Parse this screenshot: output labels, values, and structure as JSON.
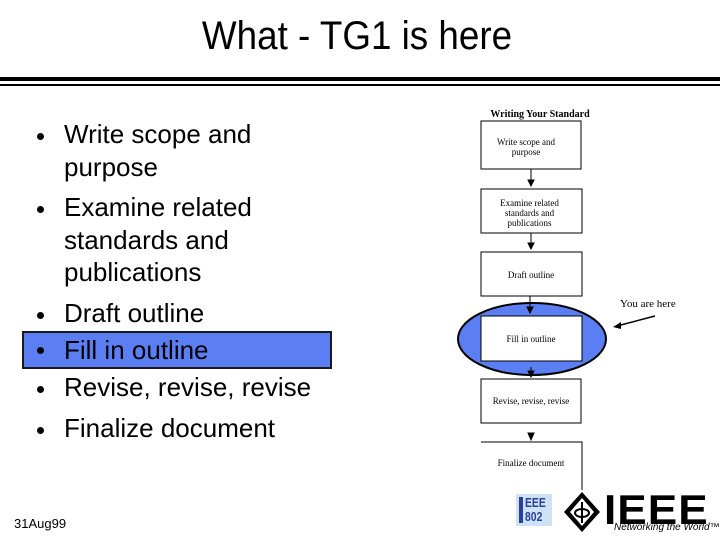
{
  "slide": {
    "title": "What - TG1 is here",
    "bullets": [
      {
        "text": "Write scope and purpose",
        "highlighted": false
      },
      {
        "text": "Examine related standards and publications",
        "highlighted": false
      },
      {
        "text": "Draft outline",
        "highlighted": false
      },
      {
        "text": "Fill in outline",
        "highlighted": true
      },
      {
        "text": "Revise, revise, revise",
        "highlighted": false
      },
      {
        "text": "Finalize document",
        "highlighted": false
      }
    ],
    "highlight_color": "#5b7ff2",
    "date": "31Aug99"
  },
  "flowchart": {
    "title": "Writing Your Standard",
    "steps": [
      "Write scope and purpose",
      "Examine related standards and publications",
      "Draft outline",
      "Fill in outline",
      "Revise, revise, revise",
      "Finalize document"
    ],
    "current_step_index": 3,
    "annotation": "You are here"
  },
  "logos": {
    "ieee802_line1": "EEE",
    "ieee802_line2": "802",
    "ieee_wordmark": "IEEE",
    "ieee_tagline": "Networking the World™"
  }
}
